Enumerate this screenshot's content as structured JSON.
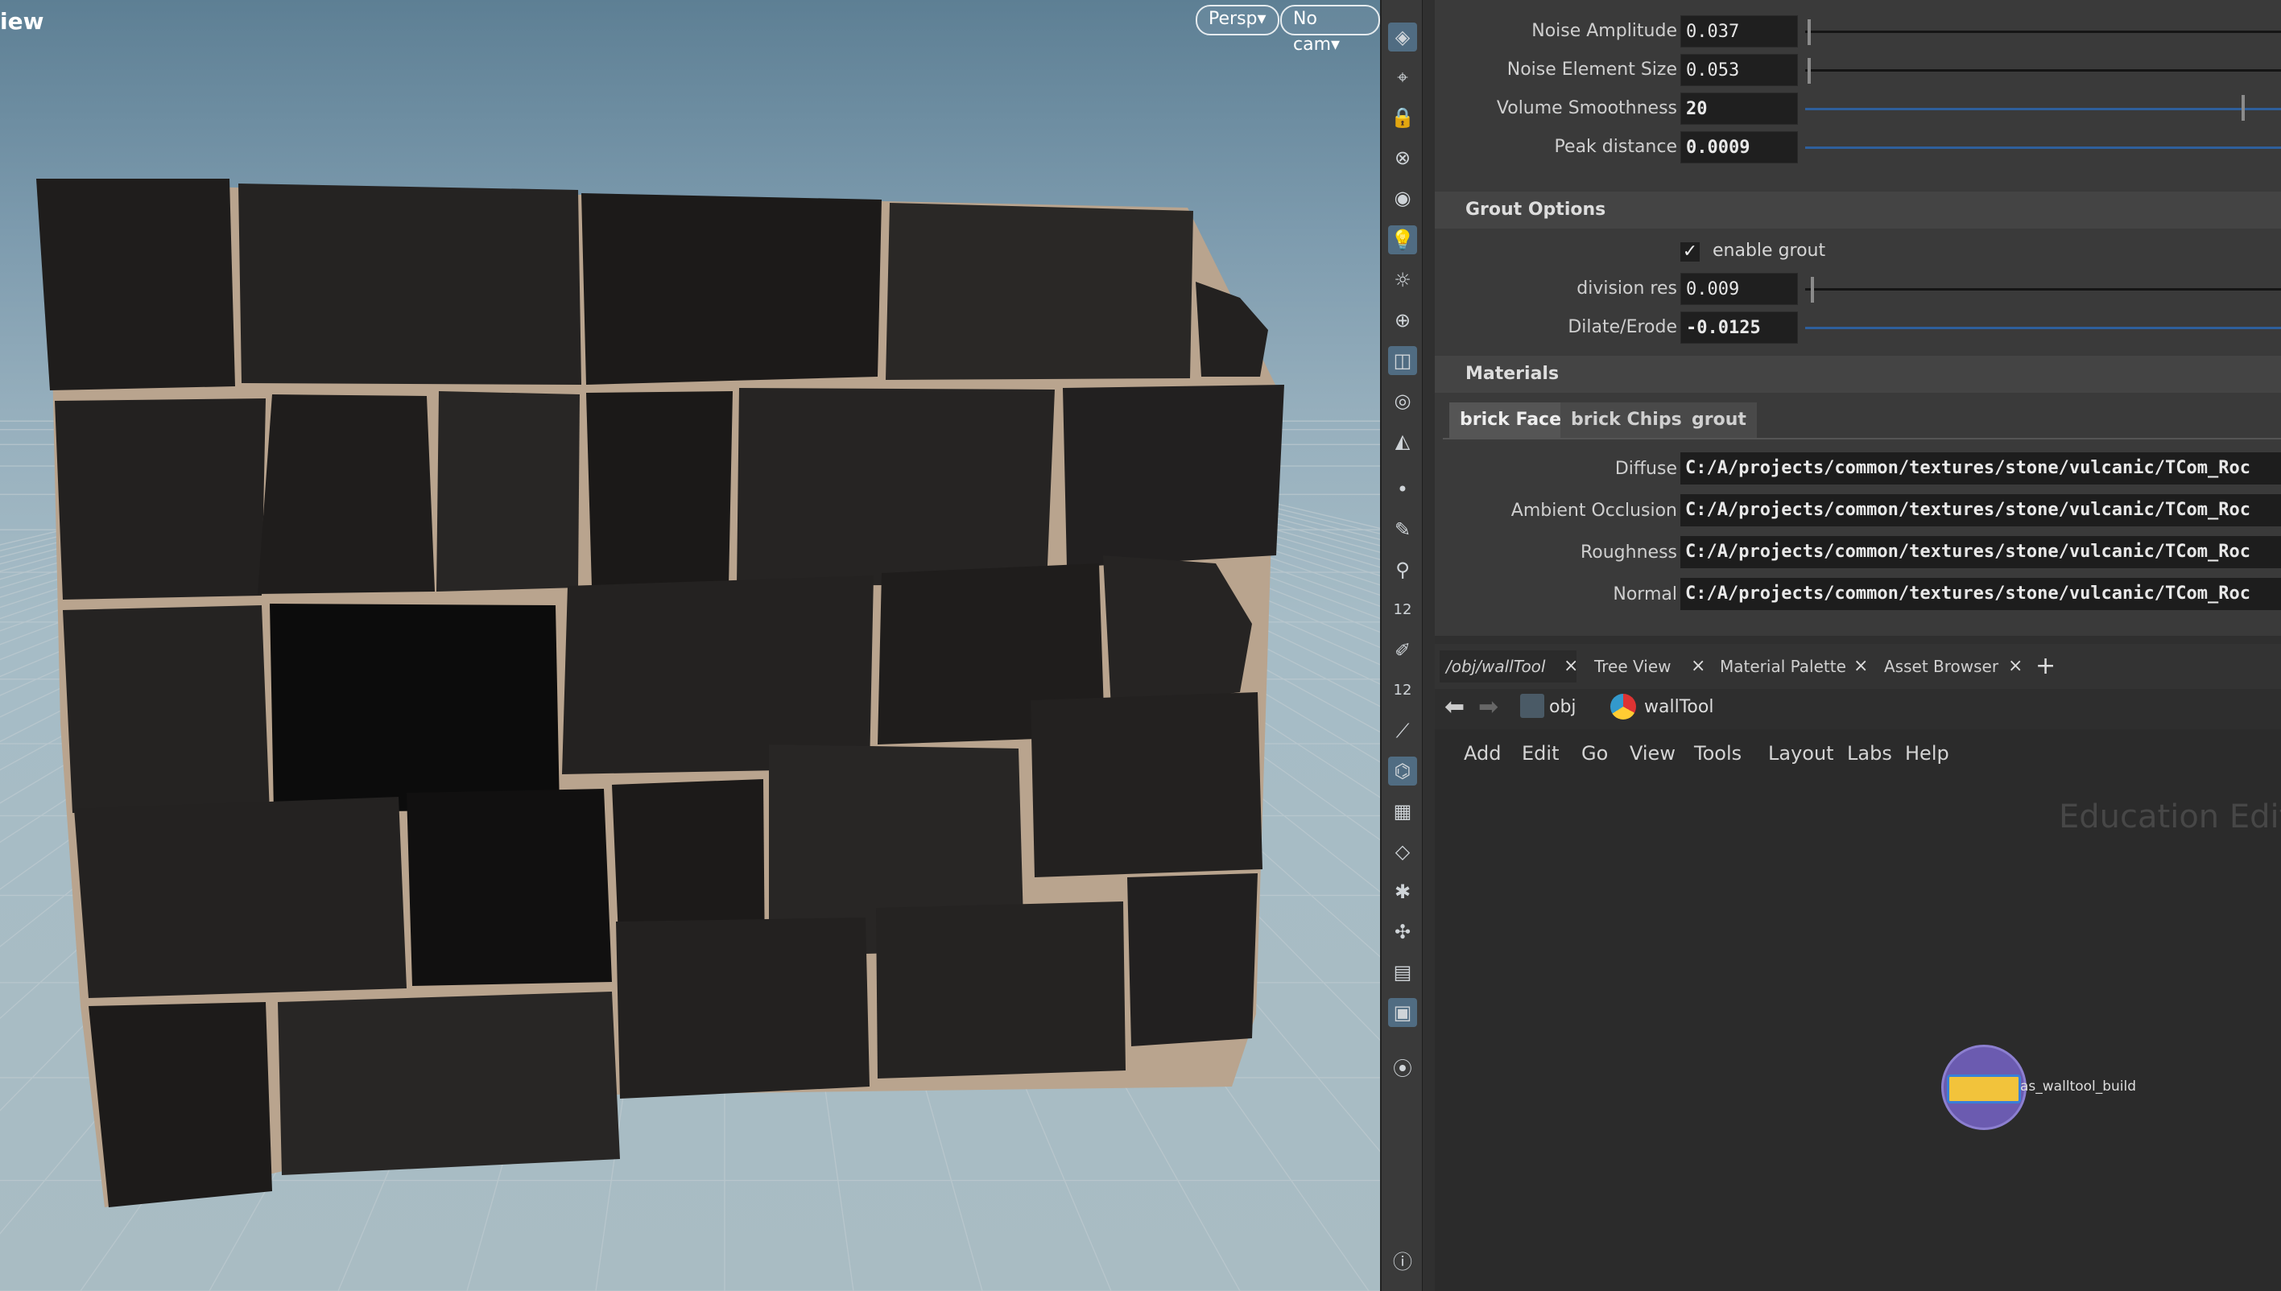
{
  "viewport": {
    "title": "iew",
    "persp_label": "Persp",
    "cam_label": "No cam",
    "menu_arrow": "▾"
  },
  "shelf": {
    "tools": [
      {
        "name": "display-options-icon",
        "glyph": "◈",
        "active": true
      },
      {
        "name": "draw-curve-icon",
        "glyph": "⌖",
        "active": false
      },
      {
        "name": "lock-icon",
        "glyph": "🔒",
        "active": false
      },
      {
        "name": "ghost-icon",
        "glyph": "⊗",
        "active": false
      },
      {
        "name": "render-sphere-icon",
        "glyph": "◉",
        "active": false
      },
      {
        "name": "light-bulb-icon",
        "glyph": "💡",
        "active": true
      },
      {
        "name": "light-ambient-icon",
        "glyph": "☼",
        "active": false
      },
      {
        "name": "light-target-icon",
        "glyph": "⊕",
        "active": false
      },
      {
        "name": "camera-icon",
        "glyph": "◫",
        "active": true
      },
      {
        "name": "view-camera-icon",
        "glyph": "◎",
        "active": false
      },
      {
        "name": "view-tool-icon",
        "glyph": "◭",
        "active": false
      },
      {
        "name": "point-icon",
        "glyph": "•",
        "active": false
      },
      {
        "name": "brush-icon",
        "glyph": "✎",
        "active": false
      },
      {
        "name": "pipette-icon",
        "glyph": "⚲",
        "active": false
      },
      {
        "name": "number-12-icon",
        "glyph": "12",
        "active": false
      },
      {
        "name": "paint-icon",
        "glyph": "✐",
        "active": false
      },
      {
        "name": "number-12-alt-icon",
        "glyph": "12",
        "active": false
      },
      {
        "name": "bone-icon",
        "glyph": "⟋",
        "active": false
      },
      {
        "name": "snap-icon",
        "glyph": "⌬",
        "active": true
      },
      {
        "name": "checker-icon",
        "glyph": "▦",
        "active": false
      },
      {
        "name": "grid-plane-icon",
        "glyph": "◇",
        "active": false
      },
      {
        "name": "geometry-icon",
        "glyph": "✱",
        "active": false
      },
      {
        "name": "handle-icon",
        "glyph": "✣",
        "active": false
      },
      {
        "name": "layer-icon",
        "glyph": "▤",
        "active": false
      },
      {
        "name": "background-image-icon",
        "glyph": "▣",
        "active": true
      },
      {
        "name": "pin-icon",
        "glyph": "⦿",
        "active": false
      },
      {
        "name": "info-icon",
        "glyph": "ⓘ",
        "active": false
      }
    ]
  },
  "params": {
    "noise_amplitude": {
      "label": "Noise Amplitude",
      "value": "0.037"
    },
    "noise_element_size": {
      "label": "Noise Element Size",
      "value": "0.053"
    },
    "volume_smoothness": {
      "label": "Volume Smoothness",
      "value": "20"
    },
    "peak_distance": {
      "label": "Peak distance",
      "value": "0.0009"
    },
    "grout_section": "Grout Options",
    "enable_grout": {
      "label": "enable grout",
      "checked": true
    },
    "division_res": {
      "label": "division res",
      "value": "0.009"
    },
    "dilate_erode": {
      "label": "Dilate/Erode",
      "value": "-0.0125"
    },
    "materials_section": "Materials",
    "material_tabs": [
      "brick Face",
      "brick Chips",
      "grout"
    ],
    "diffuse": {
      "label": "Diffuse",
      "value": "C:/A/projects/common/textures/stone/vulcanic/TCom_Roc"
    },
    "ambient_occlusion": {
      "label": "Ambient Occlusion",
      "value": "C:/A/projects/common/textures/stone/vulcanic/TCom_Roc"
    },
    "roughness": {
      "label": "Roughness",
      "value": "C:/A/projects/common/textures/stone/vulcanic/TCom_Roc"
    },
    "normal": {
      "label": "Normal",
      "value": "C:/A/projects/common/textures/stone/vulcanic/TCom_Roc"
    }
  },
  "network": {
    "tabs": [
      "/obj/wallTool",
      "Tree View",
      "Material Palette",
      "Asset Browser"
    ],
    "close_glyph": "×",
    "add_tab": "+",
    "path_obj": "obj",
    "path_node": "wallTool",
    "menu": [
      "Add",
      "Edit",
      "Go",
      "View",
      "Tools",
      "Layout",
      "Labs",
      "Help"
    ],
    "watermark": "Education Editio",
    "node_label": "as_walltool_build"
  },
  "colors": {
    "accent": "#2e5f9c",
    "panel": "#3a3a3a",
    "field": "#1f1f1f"
  }
}
